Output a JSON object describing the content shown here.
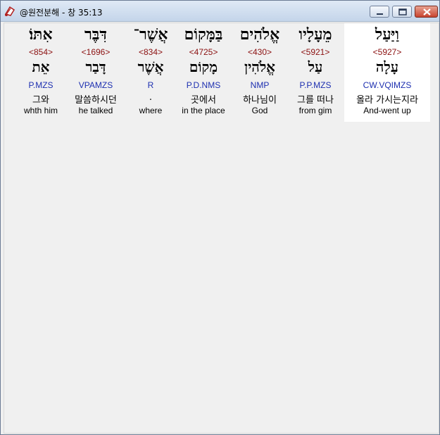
{
  "window": {
    "title": "@원전분해 - 창 35:13",
    "icon": "app-bible-icon",
    "controls": {
      "minimize": "minimize-icon",
      "maximize": "maximize-icon",
      "close": "close-icon"
    }
  },
  "words": [
    {
      "hebrew": "וַיַּעַל",
      "strong": "<5927>",
      "lemma": "עָלָה",
      "morph": "CW.VQIMZS",
      "korean": "올라 가시는지라",
      "english": "And-went up",
      "selected": true
    },
    {
      "hebrew": "מֵעָלָיו",
      "strong": "<5921>",
      "lemma": "עַל",
      "morph": "P.P.MZS",
      "korean": "그를 떠나",
      "english": "from gim",
      "selected": false
    },
    {
      "hebrew": "אֱלֹהִים",
      "strong": "<430>",
      "lemma": "אֱלֹהִין",
      "morph": "NMP",
      "korean": "하나님이",
      "english": "God",
      "selected": false
    },
    {
      "hebrew": "בַּמָּקוֹם",
      "strong": "<4725>",
      "lemma": "מָקוֹם",
      "morph": "P.D.NMS",
      "korean": "곳에서",
      "english": "in the place",
      "selected": false
    },
    {
      "hebrew": "אֲשֶׁר־",
      "strong": "<834>",
      "lemma": "אֲשֶׁר",
      "morph": "R",
      "korean": ".",
      "english": "where",
      "selected": false
    },
    {
      "hebrew": "דִּבֶּר",
      "strong": "<1696>",
      "lemma": "דָּבַר",
      "morph": "VPAMZS",
      "korean": "말씀하시던",
      "english": "he talked",
      "selected": false
    },
    {
      "hebrew": "אִתּוֹ׃",
      "strong": "<854>",
      "lemma": "אֵת",
      "morph": "P.MZS",
      "korean": "그와",
      "english": "whth him",
      "selected": false
    }
  ],
  "colors": {
    "strong": "#8b1010",
    "morph": "#1d2fb0",
    "selected_bg": "#ffffff",
    "panel_bg": "#f0f0f0"
  }
}
